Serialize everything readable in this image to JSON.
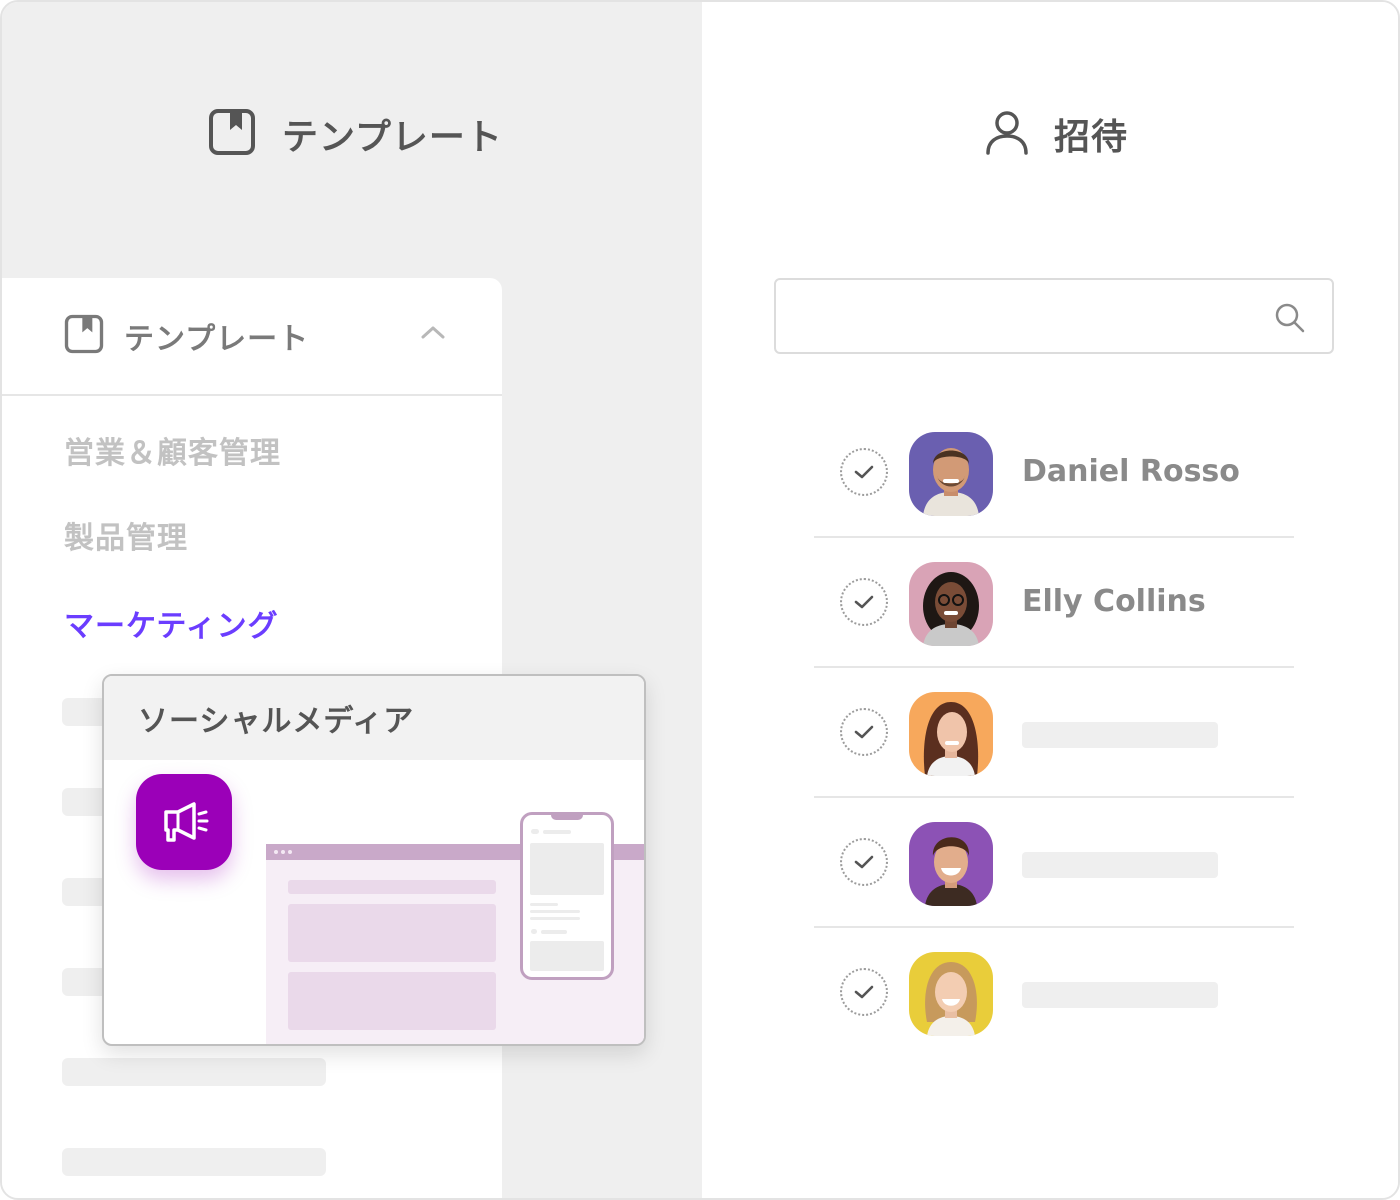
{
  "left_panel": {
    "title": "テンプレート",
    "title_icon": "template-book-icon"
  },
  "right_panel": {
    "title": "招待",
    "title_icon": "user-icon"
  },
  "templates": {
    "header_label": "テンプレート",
    "header_icon": "template-book-icon",
    "toggle_icon": "chevron-up-icon",
    "categories": [
      {
        "label": "営業＆顧客管理",
        "active": false
      },
      {
        "label": "製品管理",
        "active": false
      },
      {
        "label": "マーケティング",
        "active": true
      }
    ],
    "accent_color": "#6b3dff"
  },
  "popup": {
    "title": "ソーシャルメディア",
    "icon": "megaphone-icon",
    "icon_color": "#9b00b8"
  },
  "invite": {
    "search": {
      "value": "",
      "placeholder": "",
      "icon": "search-icon"
    },
    "users": [
      {
        "name": "Daniel Rosso",
        "avatar_bg": "#6a5fb0"
      },
      {
        "name": "Elly Collins",
        "avatar_bg": "#d9a3b6"
      },
      {
        "name": "",
        "avatar_bg": "#f7a85c"
      },
      {
        "name": "",
        "avatar_bg": "#8c52b5"
      },
      {
        "name": "",
        "avatar_bg": "#e9cd3a"
      }
    ]
  }
}
